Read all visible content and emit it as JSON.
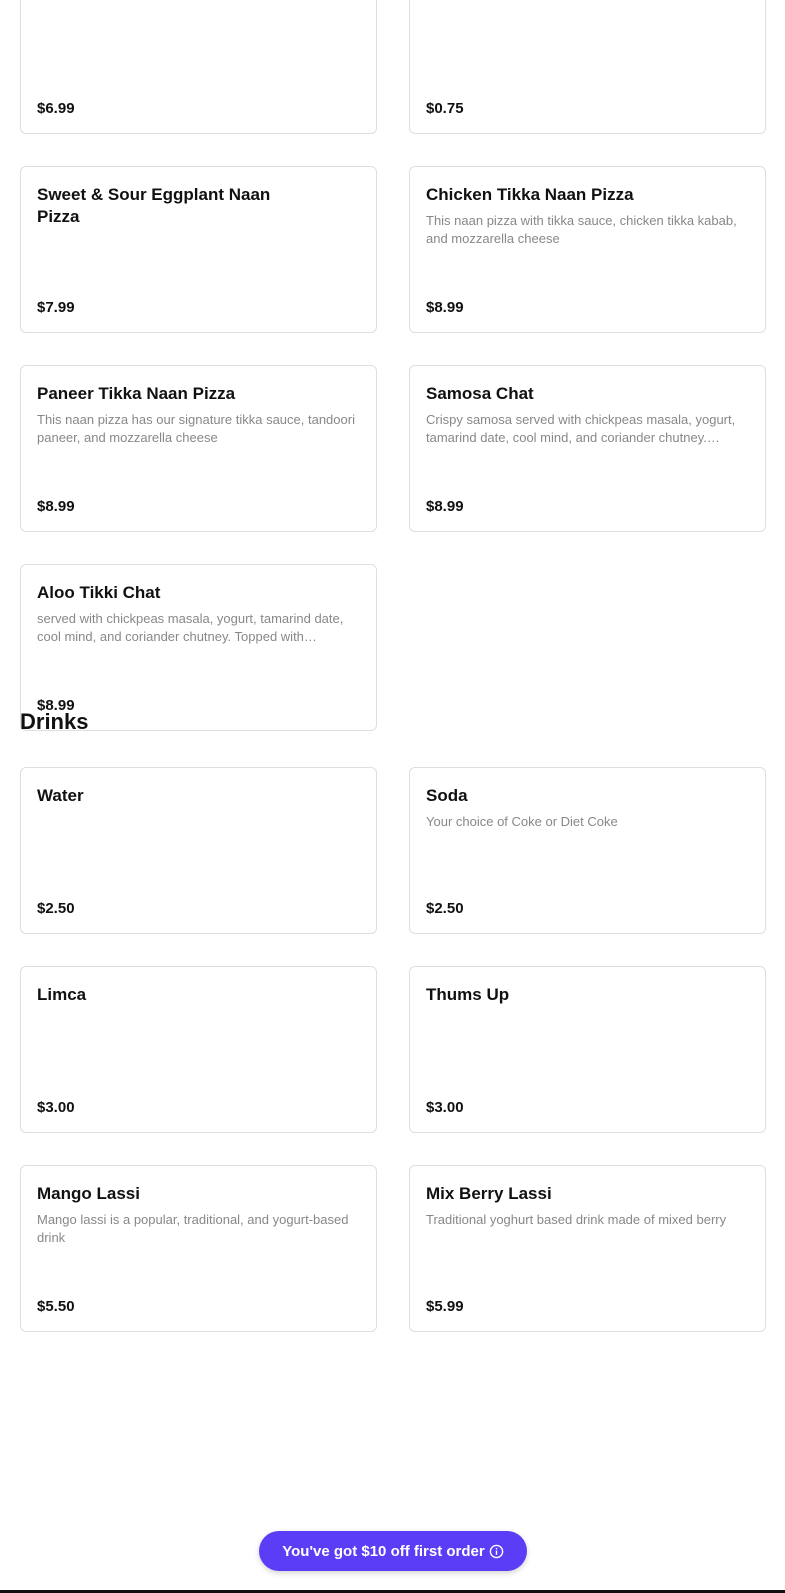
{
  "top_items": [
    {
      "name": "",
      "description": "",
      "price": "$6.99"
    },
    {
      "name": "",
      "description": "",
      "price": "$0.75"
    },
    {
      "name": "Sweet & Sour Eggplant Naan Pizza",
      "description": "",
      "price": "$7.99"
    },
    {
      "name": "Chicken Tikka Naan Pizza",
      "description": "This naan pizza with tikka sauce, chicken tikka kabab, and mozzarella cheese",
      "price": "$8.99"
    },
    {
      "name": "Paneer Tikka Naan Pizza",
      "description": "This naan pizza has our signature tikka sauce, tandoori paneer, and mozzarella cheese",
      "price": "$8.99"
    },
    {
      "name": "Samosa Chat",
      "description": "Crispy samosa served with chickpeas masala, yogurt, tamarind date, cool mind, and coriander chutney. Toppe…",
      "price": "$8.99"
    },
    {
      "name": "Aloo Tikki Chat",
      "description": "served with chickpeas masala, yogurt, tamarind date, cool mind, and coriander chutney. Topped with tomatoe…",
      "price": "$8.99"
    }
  ],
  "drinks": {
    "title": "Drinks",
    "items": [
      {
        "name": "Water",
        "description": "",
        "price": "$2.50"
      },
      {
        "name": "Soda",
        "description": "Your choice of Coke or Diet Coke",
        "price": "$2.50"
      },
      {
        "name": "Limca",
        "description": "",
        "price": "$3.00"
      },
      {
        "name": "Thums Up",
        "description": "",
        "price": "$3.00"
      },
      {
        "name": "Mango Lassi",
        "description": "Mango lassi is a popular, traditional, and yogurt-based drink",
        "price": "$5.50"
      },
      {
        "name": "Mix Berry Lassi",
        "description": "Traditional yoghurt based drink made of mixed berry",
        "price": "$5.99"
      }
    ]
  },
  "promo": {
    "label": "You've got $10 off first order",
    "icon": "info-icon",
    "color": "#5b3df5"
  }
}
